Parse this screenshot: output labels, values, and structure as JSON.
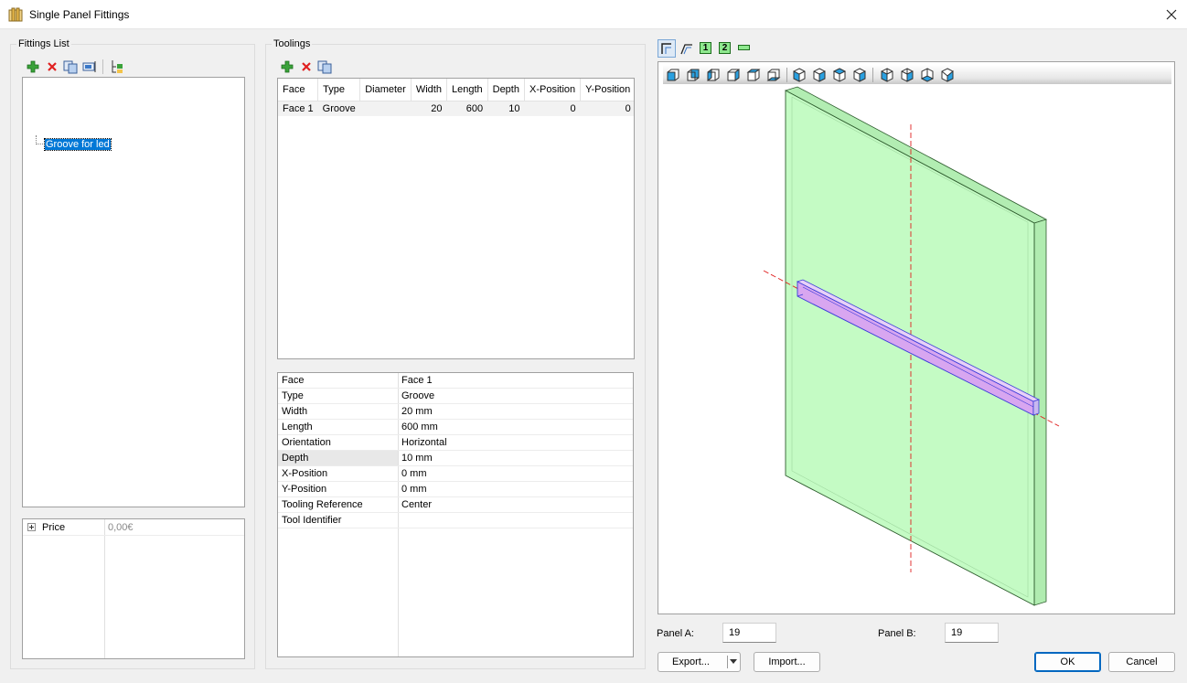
{
  "window": {
    "title": "Single Panel Fittings"
  },
  "fittings": {
    "group_label": "Fittings List",
    "tree_items": [
      {
        "label": "Groove for led",
        "selected": true
      }
    ],
    "price": {
      "label": "Price",
      "value": "0,00€"
    }
  },
  "toolings": {
    "group_label": "Toolings",
    "columns": [
      "Face",
      "Type",
      "Diameter",
      "Width",
      "Length",
      "Depth",
      "X-Position",
      "Y-Position"
    ],
    "rows": [
      {
        "face": "Face 1",
        "type": "Groove",
        "diameter": "",
        "width": "20",
        "length": "600",
        "depth": "10",
        "x": "0",
        "y": "0"
      }
    ],
    "properties": [
      {
        "key": "Face",
        "value": "Face 1"
      },
      {
        "key": "Type",
        "value": "Groove"
      },
      {
        "key": "Width",
        "value": "20 mm"
      },
      {
        "key": "Length",
        "value": "600 mm"
      },
      {
        "key": "Orientation",
        "value": "Horizontal"
      },
      {
        "key": "Depth",
        "value": "10 mm"
      },
      {
        "key": "X-Position",
        "value": "0 mm"
      },
      {
        "key": "Y-Position",
        "value": "0 mm"
      },
      {
        "key": "Tooling Reference",
        "value": "Center"
      },
      {
        "key": "Tool Identifier",
        "value": ""
      }
    ]
  },
  "viewer": {
    "mode_buttons": [
      "1",
      "2"
    ],
    "panel_a": {
      "label": "Panel A:",
      "value": "19"
    },
    "panel_b": {
      "label": "Panel B:",
      "value": "19"
    }
  },
  "buttons": {
    "export": "Export...",
    "import": "Import...",
    "ok": "OK",
    "cancel": "Cancel"
  },
  "colors": {
    "panel_fill": "#c4fbc4",
    "groove": "#3b3bd9",
    "axis": "#e02020",
    "selection": "#0078d7"
  }
}
